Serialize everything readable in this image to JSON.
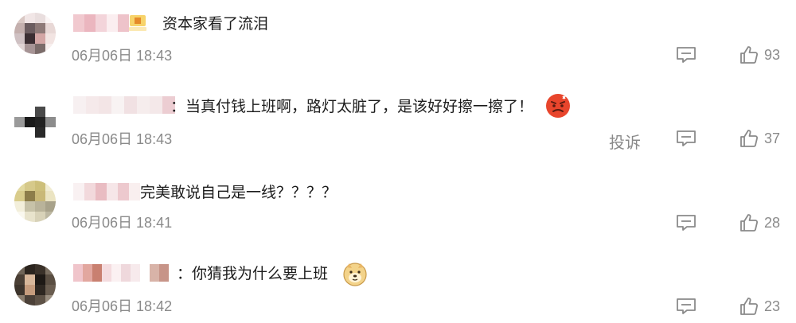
{
  "comments": [
    {
      "text": "资本家看了流泪",
      "time": "06月06日 18:43",
      "likes": "93",
      "report": ""
    },
    {
      "text": "：当真付钱上班啊，路灯太脏了，是该好好擦一擦了！",
      "time": "06月06日 18:43",
      "likes": "37",
      "report": "投诉",
      "emoji": "angry-face-icon"
    },
    {
      "text": "完美敢说自己是一线？？？？",
      "time": "06月06日 18:41",
      "likes": "28",
      "report": ""
    },
    {
      "text": "：你猜我为什么要上班",
      "time": "06月06日 18:42",
      "likes": "23",
      "report": "",
      "emoji": "doge-face-icon"
    }
  ],
  "colors": {
    "text": "#1c1c1c",
    "meta": "#8a8a8a",
    "icon_stroke": "#8a8a8a",
    "angry_emoji": "#e8452c",
    "doge_emoji": "#f3d38a"
  }
}
